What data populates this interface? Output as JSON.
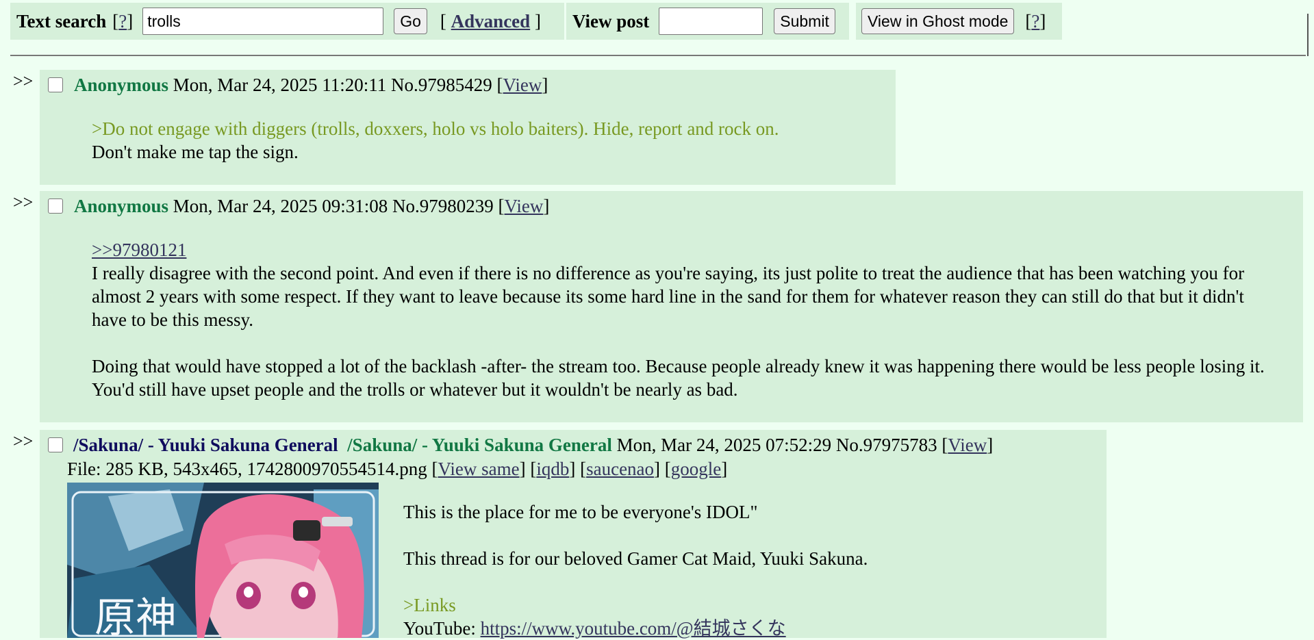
{
  "search": {
    "label": "Text search",
    "help_open": "[",
    "help_q": "?",
    "help_close": "]",
    "value": "trolls",
    "go": "Go",
    "adv_open": "[",
    "advanced": "Advanced",
    "adv_close": "]"
  },
  "viewpost": {
    "label": "View post",
    "value": "",
    "submit": "Submit"
  },
  "ghost": {
    "button": "View in Ghost mode",
    "help_q": "?"
  },
  "posts": [
    {
      "arrows": ">>",
      "name": "Anonymous",
      "date": "Mon, Mar 24, 2025 11:20:11",
      "number": "No.97985429",
      "view": "View",
      "greentext": ">Do not engage with diggers (trolls, doxxers, holo vs holo baiters). Hide, report and rock on.",
      "text": "Don't make me tap the sign."
    },
    {
      "arrows": ">>",
      "name": "Anonymous",
      "date": "Mon, Mar 24, 2025 09:31:08",
      "number": "No.97980239",
      "view": "View",
      "quotelink": ">>97980121",
      "para1": "I really disagree with the second point. And even if there is no difference as you're saying, its just polite to treat the audience that has been watching you for almost 2 years with some respect. If they want to leave because its some hard line in the sand for them for whatever reason they can still do that but it didn't have to be this messy.",
      "para2": "Doing that would have stopped a lot of the backlash -after- the stream too. Because people already knew it was happening there would be less people losing it. You'd still have upset people and the trolls or whatever but it wouldn't be nearly as bad."
    },
    {
      "arrows": ">>",
      "subject": "/Sakuna/ - Yuuki Sakuna General",
      "name": "/Sakuna/ - Yuuki Sakuna General",
      "date": "Mon, Mar 24, 2025 07:52:29",
      "number": "No.97975783",
      "view": "View",
      "file": "File: 285 KB, 543x465, 1742800970554514.png",
      "view_same": "View same",
      "iqdb": "iqdb",
      "saucenao": "saucenao",
      "google": "google",
      "line1": "This is the place for me to be everyone's IDOL\"",
      "line2": "This thread is for our beloved Gamer Cat Maid, Yuuki Sakuna.",
      "greentext": ">Links",
      "youtube_label": "YouTube: ",
      "youtube_url": "https://www.youtube.com/@結城さくな",
      "thumb_text": "原神"
    }
  ]
}
